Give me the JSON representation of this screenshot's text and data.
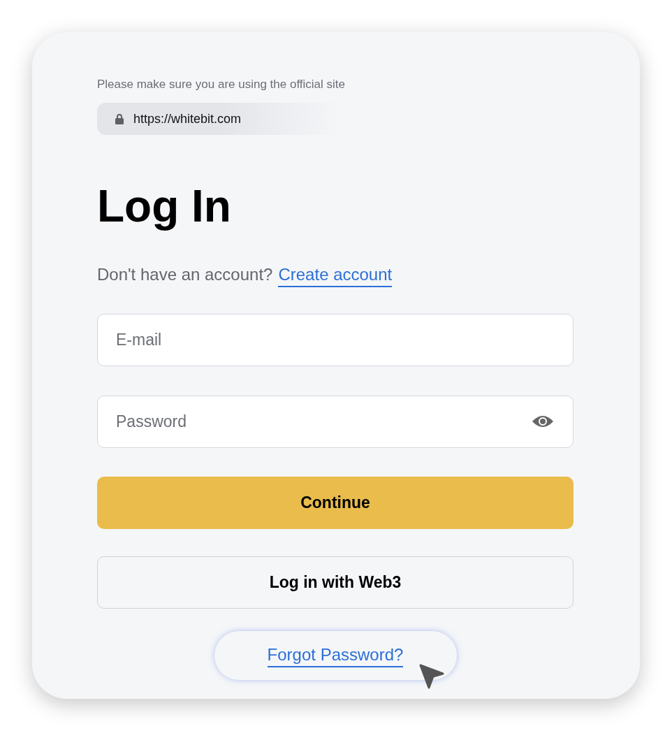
{
  "notice": "Please make sure you are using the official site",
  "url": "https://whitebit.com",
  "title": "Log In",
  "signup": {
    "prompt": "Don't have an account?",
    "link": "Create account"
  },
  "fields": [
    {
      "placeholder": "E-mail",
      "kind": "text"
    },
    {
      "placeholder": "Password",
      "kind": "password"
    }
  ],
  "buttons": [
    {
      "label": "Continue",
      "kind": "primary"
    },
    {
      "label": "Log in with Web3",
      "kind": "secondary"
    }
  ],
  "forgot_link": "Forgot Password?"
}
